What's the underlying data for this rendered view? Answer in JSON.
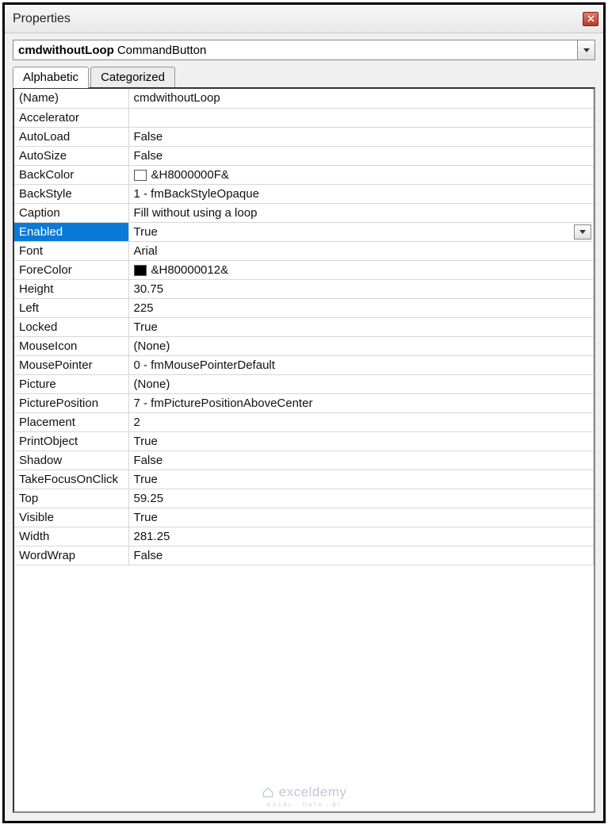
{
  "window": {
    "title": "Properties"
  },
  "objectSelector": {
    "name": "cmdwithoutLoop",
    "type": "CommandButton"
  },
  "tabs": {
    "alphabetic": "Alphabetic",
    "categorized": "Categorized",
    "active": "alphabetic"
  },
  "selectedProperty": "Enabled",
  "properties": [
    {
      "name": "(Name)",
      "value": "cmdwithoutLoop"
    },
    {
      "name": "Accelerator",
      "value": ""
    },
    {
      "name": "AutoLoad",
      "value": "False"
    },
    {
      "name": "AutoSize",
      "value": "False"
    },
    {
      "name": "BackColor",
      "value": "&H8000000F&",
      "swatch": "white"
    },
    {
      "name": "BackStyle",
      "value": "1 - fmBackStyleOpaque"
    },
    {
      "name": "Caption",
      "value": "Fill without using a loop"
    },
    {
      "name": "Enabled",
      "value": "True"
    },
    {
      "name": "Font",
      "value": "Arial"
    },
    {
      "name": "ForeColor",
      "value": "&H80000012&",
      "swatch": "black"
    },
    {
      "name": "Height",
      "value": "30.75"
    },
    {
      "name": "Left",
      "value": "225"
    },
    {
      "name": "Locked",
      "value": "True"
    },
    {
      "name": "MouseIcon",
      "value": "(None)"
    },
    {
      "name": "MousePointer",
      "value": "0 - fmMousePointerDefault"
    },
    {
      "name": "Picture",
      "value": "(None)"
    },
    {
      "name": "PicturePosition",
      "value": "7 - fmPicturePositionAboveCenter"
    },
    {
      "name": "Placement",
      "value": "2"
    },
    {
      "name": "PrintObject",
      "value": "True"
    },
    {
      "name": "Shadow",
      "value": "False"
    },
    {
      "name": "TakeFocusOnClick",
      "value": "True"
    },
    {
      "name": "Top",
      "value": "59.25"
    },
    {
      "name": "Visible",
      "value": "True"
    },
    {
      "name": "Width",
      "value": "281.25"
    },
    {
      "name": "WordWrap",
      "value": "False"
    }
  ],
  "watermark": {
    "text": "exceldemy",
    "sub": "EXCEL · DATA · BI"
  }
}
